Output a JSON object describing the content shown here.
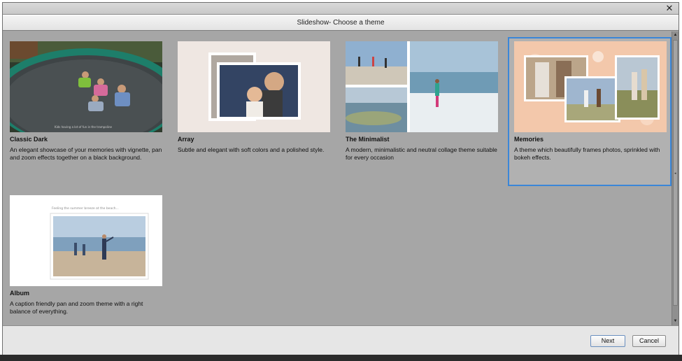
{
  "window": {
    "close_glyph": "✕"
  },
  "dialog": {
    "title": "Slideshow- Choose a theme"
  },
  "themes": [
    {
      "name": "Classic Dark",
      "description": "An elegant showcase of your memories with vignette, pan and zoom effects together on a black background.",
      "caption": "Kids having a lot of fun in the trampoline"
    },
    {
      "name": "Array",
      "description": "Subtle and elegant with soft colors and a polished style."
    },
    {
      "name": "The Minimalist",
      "description": "A modern, minimalistic and neutral collage theme suitable for every occasion"
    },
    {
      "name": "Memories",
      "description": "A theme which beautifully frames photos, sprinkled with bokeh effects.",
      "selected": true
    },
    {
      "name": "Album",
      "description": "A caption friendly pan and zoom theme with a right balance of everything.",
      "caption": "Feeling the summer breeze at the beach..."
    }
  ],
  "buttons": {
    "next": "Next",
    "cancel": "Cancel"
  },
  "colors": {
    "selection_border": "#3a86d8",
    "panel": "#a6a6a6"
  }
}
